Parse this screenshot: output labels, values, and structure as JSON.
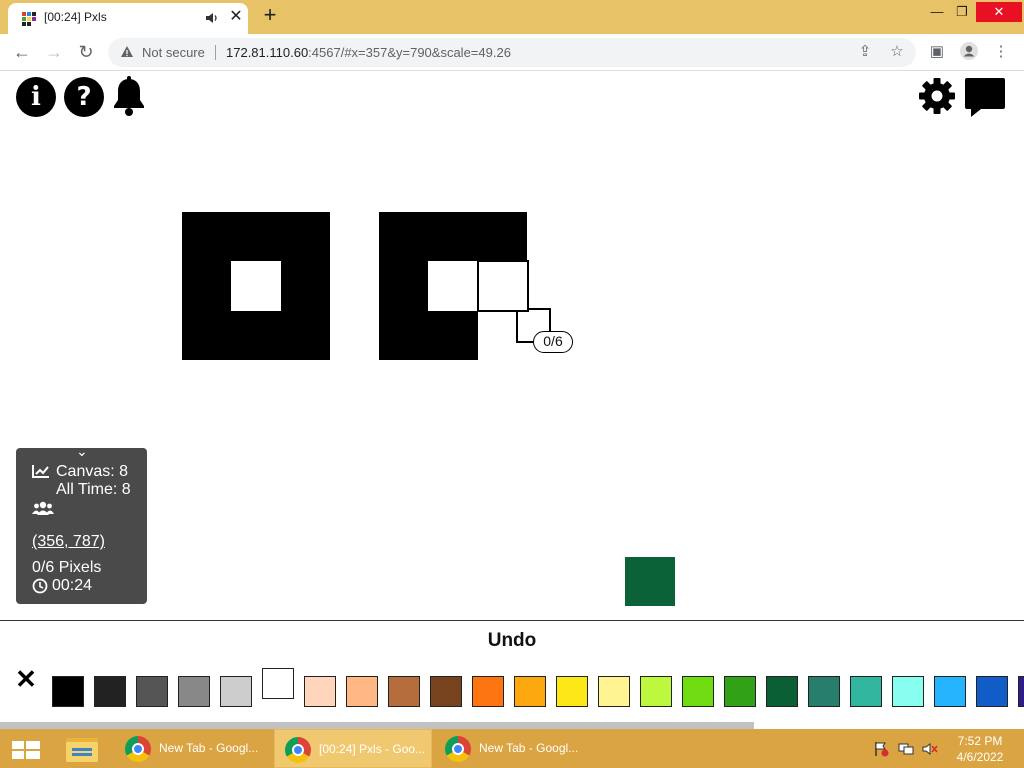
{
  "browser": {
    "tab": {
      "title": "[00:24] Pxls",
      "close_glyph": "✕"
    },
    "new_tab_glyph": "+",
    "window_controls": [
      "—",
      "❐",
      "✕"
    ],
    "toolbar": {
      "back_glyph": "←",
      "forward_glyph": "→",
      "reload_glyph": "↻",
      "security_label": "Not secure",
      "url_host": "172.81.110.60",
      "url_rest": ":4567/#x=357&y=790&scale=49.26",
      "share_glyph": "⇪",
      "bookmark_glyph": "☆",
      "sidepanel_glyph": "▣",
      "profile_glyph": "●",
      "menu_glyph": "⋮"
    }
  },
  "page": {
    "top_left_icons": [
      {
        "name": "info-icon",
        "glyph": "i"
      },
      {
        "name": "help-icon",
        "glyph": "?"
      },
      {
        "name": "bell-icon",
        "glyph": ""
      }
    ],
    "top_right_icons": [
      {
        "name": "gear-icon"
      },
      {
        "name": "chat-icon"
      }
    ],
    "cursor_bubble": "0/6",
    "info_panel": {
      "collapse_glyph": "⌄",
      "canvas_label": "Canvas: 8",
      "alltime_label": "All Time: 8",
      "users_icon": "users-icon",
      "coords": "(356, 787)",
      "pixels": "0/6 Pixels",
      "timer": "00:24"
    },
    "colors": {
      "selected_pixel": "#0b6238"
    }
  },
  "palette": {
    "undo_label": "Undo",
    "deselect_glyph": "✕",
    "swatches": [
      "#000000",
      "#222222",
      "#555555",
      "#888888",
      "#cdcdcd",
      "#ffffff",
      "#ffd5bc",
      "#ffb783",
      "#b66d3d",
      "#77431f",
      "#fc7510",
      "#fca80e",
      "#fde817",
      "#fff491",
      "#bef83e",
      "#70dd13",
      "#31a117",
      "#0b5f35",
      "#277e6c",
      "#32b69f",
      "#88ffee",
      "#24b5fe",
      "#125cc7",
      "#2e1d87"
    ],
    "selected_index": 5
  },
  "taskbar": {
    "items": [
      {
        "label": "New Tab - Googl...",
        "active": false
      },
      {
        "label": "[00:24] Pxls - Goo...",
        "active": true
      },
      {
        "label": "New Tab - Googl...",
        "active": false
      }
    ],
    "clock_time": "7:52 PM",
    "clock_date": "4/6/2022"
  }
}
